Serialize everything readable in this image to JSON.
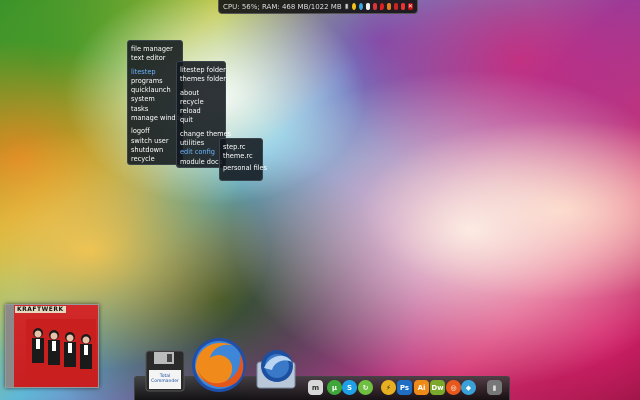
{
  "statusbar": {
    "text": "CPU: 56%; RAM: 468 MB/1022 MB",
    "tray_icons": [
      "media-icon",
      "warning-icon",
      "globe-icon",
      "mail-icon",
      "flag-icon",
      "red-drop-icon",
      "lightning-icon",
      "red-icon",
      "red-icon-2",
      "close-icon"
    ]
  },
  "menu_main": {
    "items": [
      "file manager",
      "text editor",
      "litestep",
      "programs",
      "quicklaunch",
      "system",
      "tasks",
      "manage windows",
      "logoff",
      "switch user",
      "shutdown",
      "recycle"
    ]
  },
  "menu_litestep": {
    "items": [
      "litestep folder",
      "themes folder",
      "about",
      "recycle",
      "reload",
      "quit",
      "change themes",
      "utilities",
      "edit config",
      "module docs"
    ]
  },
  "menu_config": {
    "items": [
      "step.rc",
      "theme.rc",
      "personal files"
    ]
  },
  "album": {
    "title": "KRAFTWERK"
  },
  "dock": {
    "total_commander_label": "Total Commander",
    "big_icons": [
      "total-commander",
      "firefox",
      "thunderbird"
    ],
    "small_icons": [
      {
        "name": "m-icon",
        "glyph": "m",
        "color": "#d8d8d8",
        "fg": "#333"
      },
      {
        "name": "utorrent-icon",
        "glyph": "µ",
        "color": "#3fa63a",
        "fg": "#fff"
      },
      {
        "name": "skype-icon",
        "glyph": "S",
        "color": "#1ea0e6",
        "fg": "#fff"
      },
      {
        "name": "sync-icon",
        "glyph": "↻",
        "color": "#6fbf40",
        "fg": "#fff"
      },
      {
        "name": "winamp-icon",
        "glyph": "⚡",
        "color": "#e8b020",
        "fg": "#222"
      },
      {
        "name": "photoshop-icon",
        "glyph": "Ps",
        "color": "#1e6fc4",
        "fg": "#fff"
      },
      {
        "name": "illustrator-icon",
        "glyph": "Ai",
        "color": "#ee8a18",
        "fg": "#fff"
      },
      {
        "name": "dreamweaver-icon",
        "glyph": "Dw",
        "color": "#7aa82a",
        "fg": "#fff"
      },
      {
        "name": "office-icon",
        "glyph": "◎",
        "color": "#e8581c",
        "fg": "#fff"
      },
      {
        "name": "explorer-icon",
        "glyph": "◆",
        "color": "#3aa0d8",
        "fg": "#fff"
      },
      {
        "name": "recycle-bin-icon",
        "glyph": "▮",
        "color": "#888",
        "fg": "#ddd"
      }
    ]
  }
}
